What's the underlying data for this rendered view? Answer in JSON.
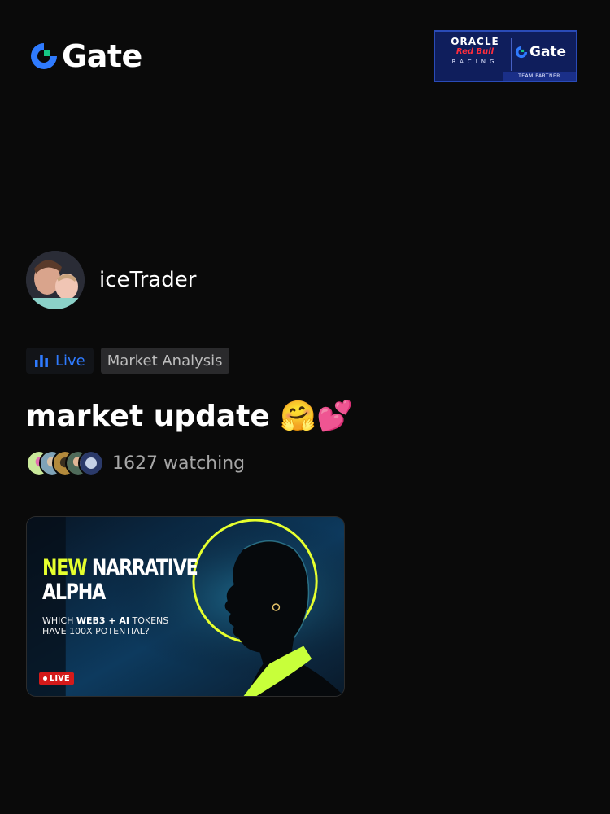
{
  "header": {
    "brand": "Gate",
    "partner": {
      "line1": "ORACLE",
      "line2": "Red Bull",
      "line3": "RACING",
      "brand": "Gate",
      "footer": "TEAM PARTNER"
    }
  },
  "profile": {
    "username": "iceTrader"
  },
  "tags": {
    "live_label": "Live",
    "category": "Market Analysis"
  },
  "stream": {
    "title": "market update 🤗💕",
    "watching": "1627 watching"
  },
  "thumbnail": {
    "headline_word1": "NEW",
    "headline_word2": "NARRATIVE",
    "headline_line2": "ALPHA",
    "sub_prefix": "WHICH ",
    "sub_bold": "WEB3 + AI",
    "sub_suffix": " TOKENS",
    "sub_line2": "HAVE 100X POTENTIAL?",
    "live_badge": "LIVE"
  },
  "colors": {
    "background": "#0a0a0a",
    "accent_blue": "#2f7bff",
    "accent_green": "#16c784",
    "neon_yellow": "#e6ff2e",
    "live_red": "#d41a1a"
  },
  "icons": {
    "brand": "gate-logo-icon",
    "live": "bar-chart-icon"
  }
}
